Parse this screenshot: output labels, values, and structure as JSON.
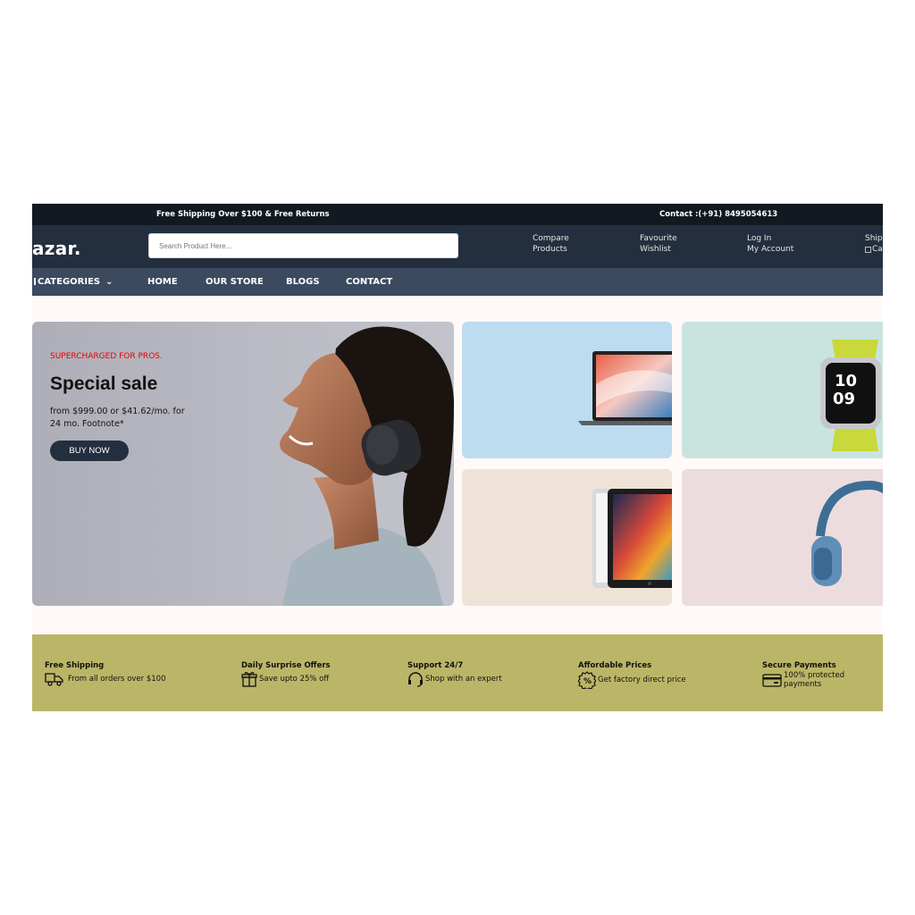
{
  "top_strip": {
    "shipping_text": "Free Shipping Over $100 & Free Returns",
    "contact_text": "Contact :(+91) 8495054613"
  },
  "header": {
    "logo": "azar.",
    "search_placeholder": "Search Product Here...",
    "links": [
      {
        "line1": "Compare",
        "line2": "Products",
        "icon": "compare-icon"
      },
      {
        "line1": "Favourite",
        "line2": "Wishlist",
        "icon": "heart-icon"
      },
      {
        "line1": "Log In",
        "line2": "My Account",
        "icon": "user-icon"
      },
      {
        "line1": "Shipp",
        "line2": "Ca",
        "icon": "cart-icon"
      }
    ]
  },
  "nav": {
    "categories_label": "CATEGORIES",
    "items": [
      "HOME",
      "OUR STORE",
      "BLOGS",
      "CONTACT"
    ]
  },
  "hero": {
    "eyebrow": "SUPERCHARGED FOR PROS.",
    "title": "Special sale",
    "price_line": "from $999.00 or $41.62/mo. for 24 mo. Footnote*",
    "button": "BUY NOW"
  },
  "services": [
    {
      "title": "Free Shipping",
      "desc": "From all orders over $100",
      "icon": "delivery-truck-icon"
    },
    {
      "title": "Daily Surprise Offers",
      "desc": "Save upto 25% off",
      "icon": "gift-icon"
    },
    {
      "title": "Support 24/7",
      "desc": "Shop with an expert",
      "icon": "headset-icon"
    },
    {
      "title": "Affordable Prices",
      "desc": "Get factory direct price",
      "icon": "discount-badge-icon"
    },
    {
      "title": "Secure Payments",
      "desc": "100% protected payments",
      "icon": "credit-card-icon"
    }
  ],
  "colors": {
    "top_strip_bg": "#131921",
    "header_bg": "#232f3e",
    "nav_bg": "#3b4a5e",
    "eyebrow_red": "#e00000",
    "services_bg": "#bbb667"
  }
}
